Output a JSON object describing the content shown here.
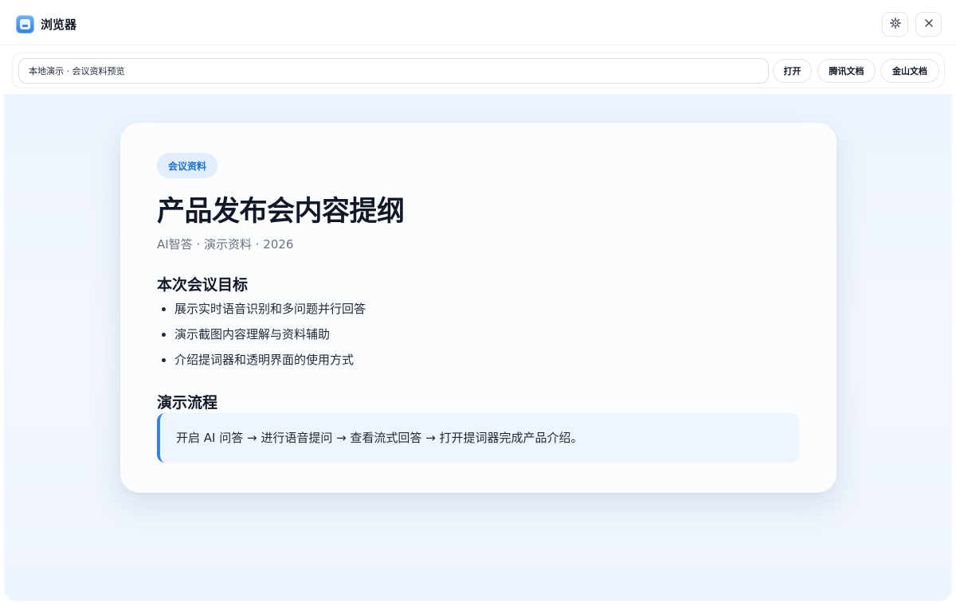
{
  "window": {
    "title": "浏览器",
    "app_icon": "browser-app-icon",
    "controls": [
      {
        "name": "settings",
        "icon": "gear-icon"
      },
      {
        "name": "close",
        "icon": "close-icon"
      }
    ]
  },
  "addressbar": {
    "value": "本地演示 · 会议资料预览",
    "buttons": {
      "open": "打开",
      "tencent_docs": "腾讯文档",
      "kingsoft_docs": "金山文档"
    }
  },
  "document": {
    "tag": "会议资料",
    "title": "产品发布会内容提纲",
    "meta": "AI智答 · 演示资料 · 2026",
    "goals_heading": "本次会议目标",
    "goals": [
      "展示实时语音识别和多问题并行回答",
      "演示截图内容理解与资料辅助",
      "介绍提词器和透明界面的使用方式"
    ],
    "flow_heading": "演示流程",
    "flow_text": "开启 AI 问答 → 进行语音提问 → 查看流式回答 → 打开提词器完成产品介绍。"
  },
  "colors": {
    "accent": "#2f86e6",
    "tag_bg": "#e1eefc",
    "tag_text": "#1c6fcf",
    "viewport_bg": "#edf4fd"
  }
}
